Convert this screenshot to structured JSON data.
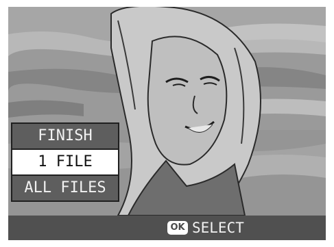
{
  "menu": {
    "items": [
      {
        "label": "FINISH",
        "selected": false
      },
      {
        "label": "1 FILE",
        "selected": true
      },
      {
        "label": "ALL FILES",
        "selected": false
      }
    ]
  },
  "bottom_bar": {
    "ok_icon_text": "OK",
    "select_label": "SELECT"
  },
  "colors": {
    "menu_item_bg": "#5e5e5e",
    "menu_selected_bg": "#ffffff",
    "bottom_bar_bg": "#505050"
  }
}
